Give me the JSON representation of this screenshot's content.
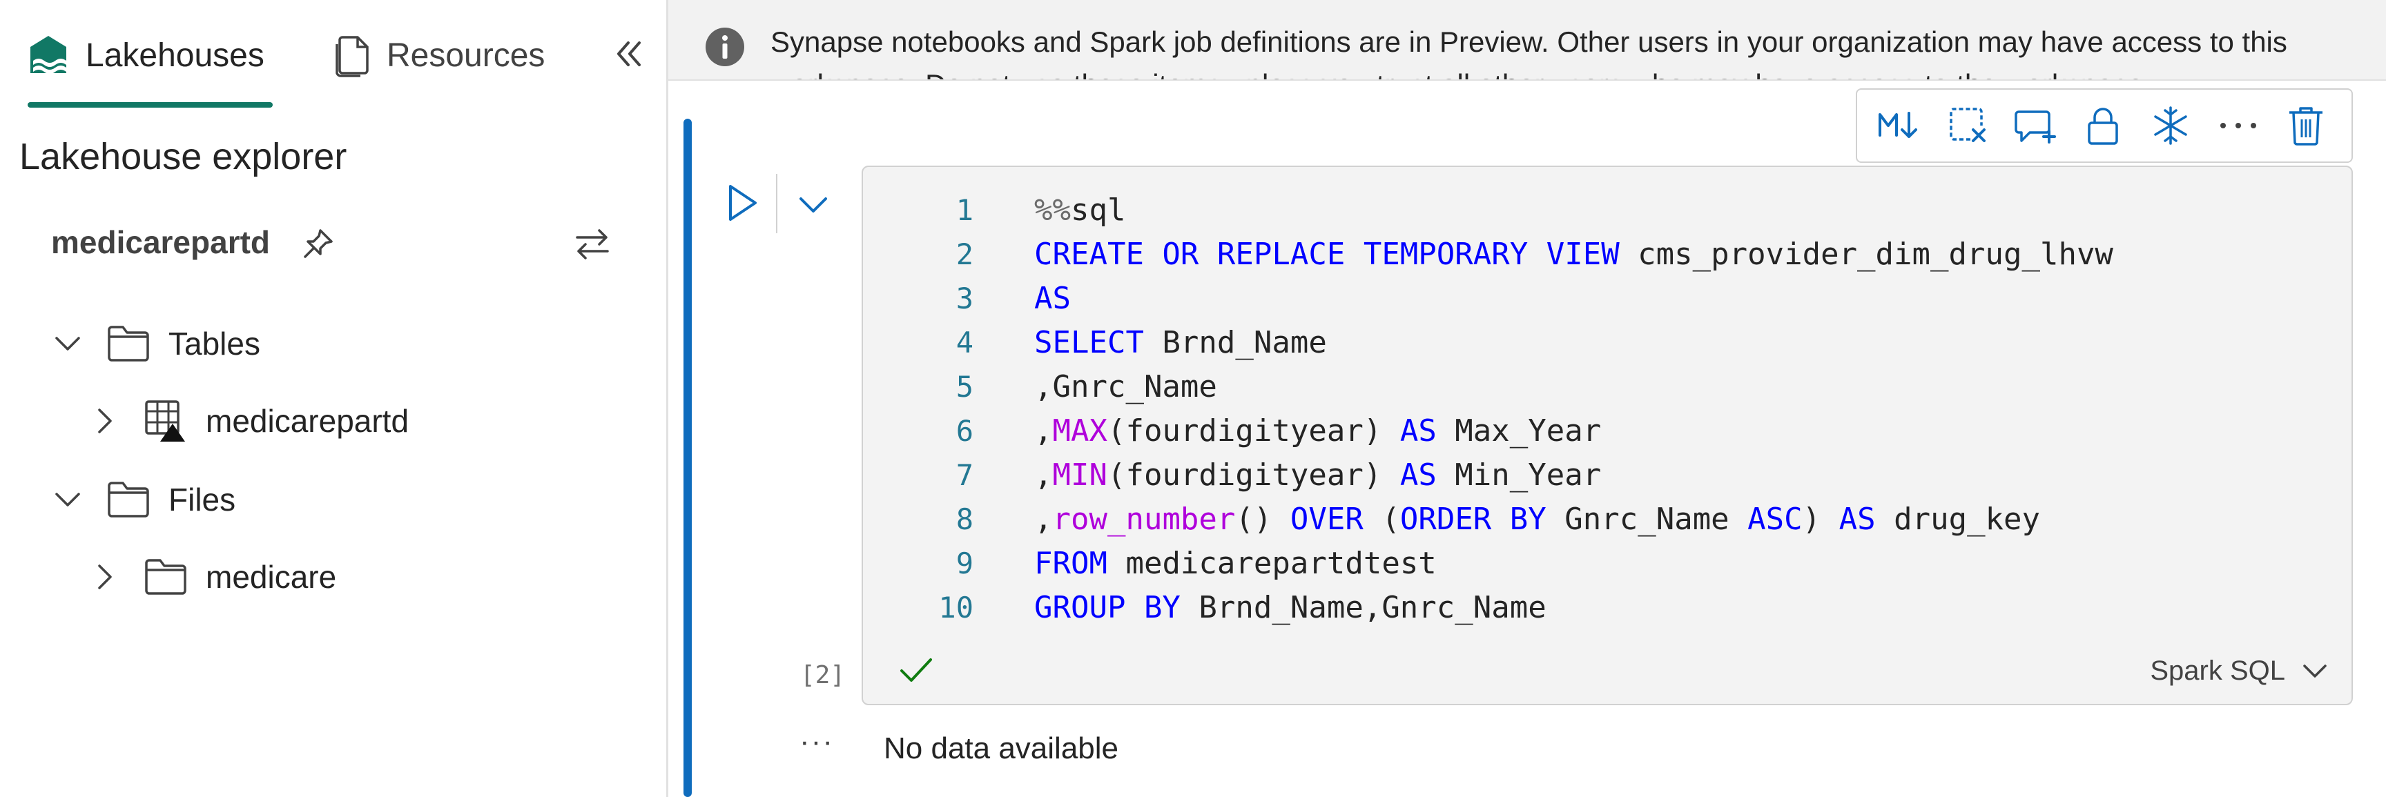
{
  "sidebar": {
    "tabs": [
      {
        "label": "Lakehouses",
        "icon": "lakehouse-icon",
        "active": true
      },
      {
        "label": "Resources",
        "icon": "document-icon",
        "active": false
      }
    ],
    "collapse_icon": "double-chevron-left-icon",
    "explorer_title": "Lakehouse explorer",
    "lakehouse_name": "medicarepartd",
    "tree": {
      "tables_label": "Tables",
      "tables_child": "medicarepartd",
      "files_label": "Files",
      "files_child": "medicare"
    }
  },
  "main": {
    "banner": "Synapse notebooks and Spark job definitions are in Preview. Other users in your organization may have access to this workspace. Do not use these items unless you trust all other users who may have access to the workspace.",
    "toolbar": [
      "markdown-icon",
      "clear-output-icon",
      "comment-icon",
      "lock-icon",
      "freeze-icon",
      "more-icon",
      "delete-icon"
    ],
    "cell": {
      "line_numbers": [
        "1",
        "2",
        "3",
        "4",
        "5",
        "6",
        "7",
        "8",
        "9",
        "10"
      ],
      "code_lines": [
        "%%sql",
        "CREATE OR REPLACE TEMPORARY VIEW cms_provider_dim_drug_lhvw",
        "AS",
        "SELECT Brnd_Name",
        ",Gnrc_Name",
        ",MAX(fourdigityear) AS Max_Year",
        ",MIN(fourdigityear) AS Min_Year",
        ",row_number() OVER (ORDER BY Gnrc_Name ASC) AS drug_key",
        "FROM medicarepartdtest",
        "GROUP BY Brnd_Name,Gnrc_Name"
      ],
      "exec_count": "[2]",
      "language": "Spark SQL"
    },
    "output": {
      "more": "···",
      "text": "No data available"
    }
  },
  "colors": {
    "accent_teal": "#117865",
    "accent_blue": "#0f6cbd",
    "keyword": "#0000ff",
    "function": "#af00db",
    "line_number": "#237893",
    "success": "#107c10"
  }
}
